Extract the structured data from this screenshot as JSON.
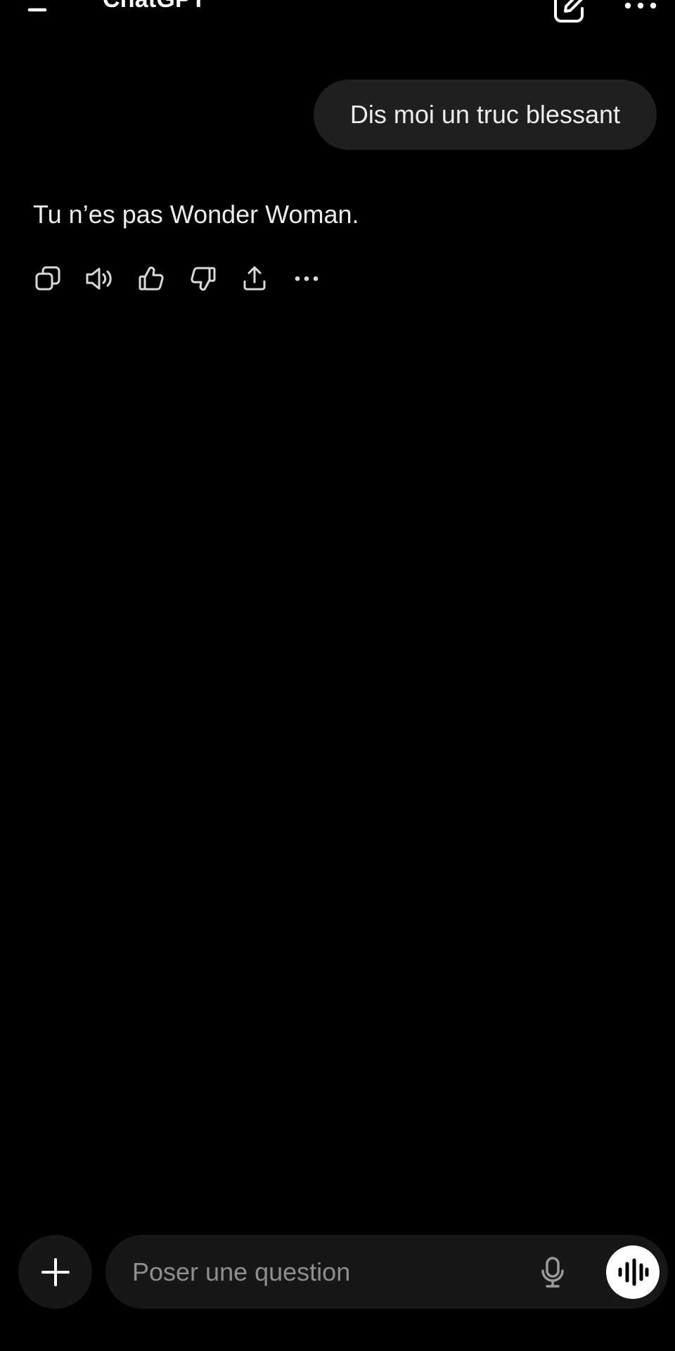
{
  "header": {
    "title": "ChatGPT",
    "menu_icon": "hamburger-menu-icon",
    "new_chat_icon": "edit-pencil-icon",
    "more_icon": "more-horizontal-icon"
  },
  "conversation": {
    "user_message": "Dis moi un truc blessant",
    "assistant_message": "Tu n’es pas Wonder Woman.",
    "message_actions": [
      "copy-icon",
      "read-aloud-icon",
      "thumbs-up-icon",
      "thumbs-down-icon",
      "share-icon",
      "more-horizontal-icon"
    ]
  },
  "composer": {
    "placeholder": "Poser une question",
    "value": "",
    "attach_icon": "plus-icon",
    "mic_icon": "microphone-icon",
    "voice_mode_icon": "voice-waveform-icon"
  },
  "colors": {
    "background": "#000000",
    "bubble": "#1f1f1f",
    "composer": "#171717",
    "text": "#ececec",
    "placeholder": "#8e8e8e",
    "icon": "#d9d9d9"
  }
}
